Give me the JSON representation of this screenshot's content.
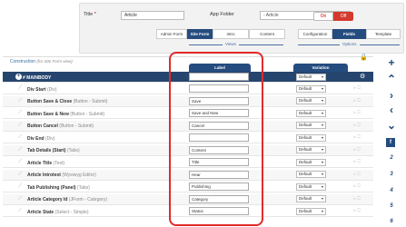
{
  "header": {
    "title_label": "Title",
    "required_mark": "*",
    "title_value": "Article",
    "app_folder_label": "App Folder",
    "app_folder_value": "- Article",
    "on_label": "On",
    "off_label": "Off"
  },
  "tabs": {
    "views": [
      "Admin Form",
      "Site Form",
      "Intro",
      "Content"
    ],
    "options": [
      "Configuration",
      "Fields",
      "Template"
    ],
    "views_label": "Views",
    "options_label": "Options",
    "active_view": "Site Form",
    "active_option": "Fields"
  },
  "construction": {
    "title": "Construction",
    "subtitle": "(for Site Form view)",
    "col_label": "Label",
    "col_variation": "Variation"
  },
  "main_row": {
    "name": "# MAINBODY",
    "variation": "Default"
  },
  "rows": [
    {
      "name": "Div Start",
      "type": "(Div)",
      "label": "",
      "variation": "Default"
    },
    {
      "name": "Button Save & Close",
      "type": "(Button - Submit)",
      "label": "Save",
      "variation": "Default"
    },
    {
      "name": "Button Save & New",
      "type": "(Button - Submit)",
      "label": "Save and New",
      "variation": "Default"
    },
    {
      "name": "Button Cancel",
      "type": "(Button - Submit)",
      "label": "Cancel",
      "variation": "Default"
    },
    {
      "name": "Div End",
      "type": "(Div)",
      "label": "",
      "variation": "Default"
    },
    {
      "name": "Tab Details (Start)",
      "type": "(Tabs)",
      "label": "Content",
      "variation": "Default"
    },
    {
      "name": "Article Title",
      "type": "(Text)",
      "label": "Title",
      "variation": "Default"
    },
    {
      "name": "Article Introtext",
      "type": "(Wysiwyg Editor)",
      "label": "Hear",
      "variation": "Default"
    },
    {
      "name": "Tab Publishing (Panel)",
      "type": "(Tabs)",
      "label": "Publishing",
      "variation": "Default"
    },
    {
      "name": "Article Category Id",
      "type": "(JForm - Category)",
      "label": "Category",
      "variation": "Default"
    },
    {
      "name": "Article State",
      "type": "(Select - Simple)",
      "label": "Status",
      "variation": "Default"
    }
  ],
  "side": {
    "numbers": [
      "2",
      "3",
      "4",
      "5",
      "6"
    ],
    "format_label": "f"
  },
  "colors": {
    "accent": "#254c7e",
    "highlight": "#e02a2a",
    "off_button": "#d43a2c"
  }
}
